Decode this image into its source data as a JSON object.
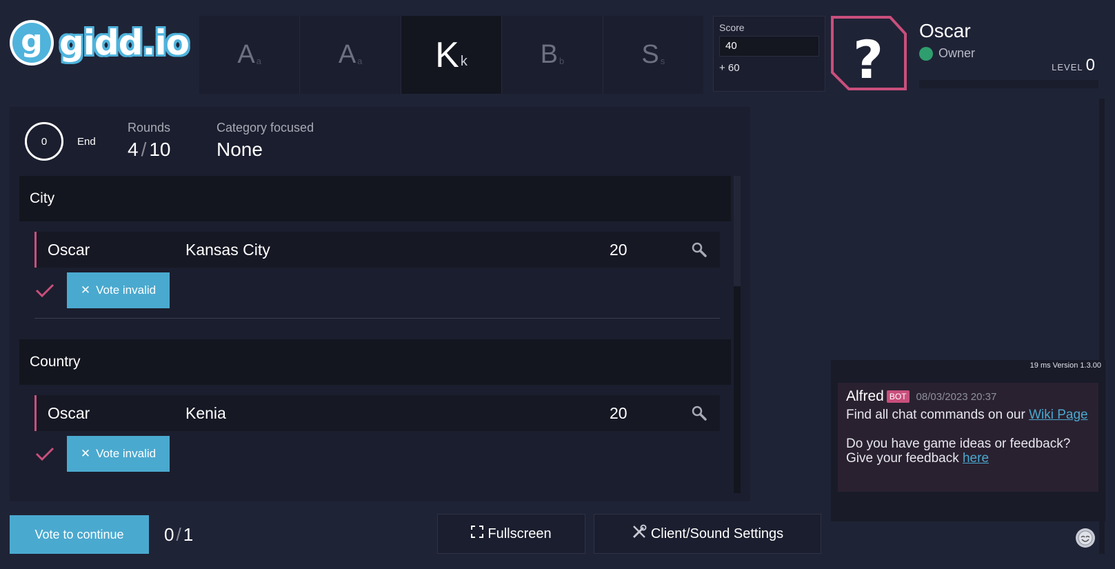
{
  "logo": {
    "mark": "g",
    "text": "gidd.io"
  },
  "letters": [
    {
      "big": "A",
      "small": "a",
      "current": false
    },
    {
      "big": "A",
      "small": "a",
      "current": false
    },
    {
      "big": "K",
      "small": "k",
      "current": true
    },
    {
      "big": "B",
      "small": "b",
      "current": false
    },
    {
      "big": "S",
      "small": "s",
      "current": false
    }
  ],
  "score": {
    "label": "Score",
    "value": "40",
    "bonus": "+ 60"
  },
  "profile": {
    "avatar": "?",
    "name": "Oscar",
    "role": "Owner",
    "level_label": "LEVEL",
    "level": "0"
  },
  "status": {
    "timer": "0",
    "end_label": "End",
    "rounds_label": "Rounds",
    "rounds_current": "4",
    "rounds_sep": "/",
    "rounds_total": "10",
    "category_label": "Category focused",
    "category_value": "None"
  },
  "categories": [
    {
      "name": "City",
      "answers": [
        {
          "player": "Oscar",
          "word": "Kansas City",
          "points": "20",
          "vote_label": "Vote invalid"
        }
      ]
    },
    {
      "name": "Country",
      "answers": [
        {
          "player": "Oscar",
          "word": "Kenia",
          "points": "20",
          "vote_label": "Vote invalid"
        }
      ]
    }
  ],
  "footer": {
    "vote_continue": "Vote to continue",
    "votes_current": "0",
    "votes_sep": "/",
    "votes_total": "1",
    "fullscreen": "Fullscreen",
    "settings": "Client/Sound Settings"
  },
  "chat": {
    "meta": "19 ms Version 1.3.00",
    "author": "Alfred",
    "badge": "BOT",
    "time": "08/03/2023 20:37",
    "line1": "Find all chat commands on our ",
    "link1": "Wiki Page",
    "line2": "Do you have game ideas or feedback? Give your feedback ",
    "link2": "here"
  },
  "colors": {
    "accent": "#4aa9cf",
    "pink": "#c94f7c",
    "online": "#2f9e6e",
    "bg": "#1f2336"
  }
}
